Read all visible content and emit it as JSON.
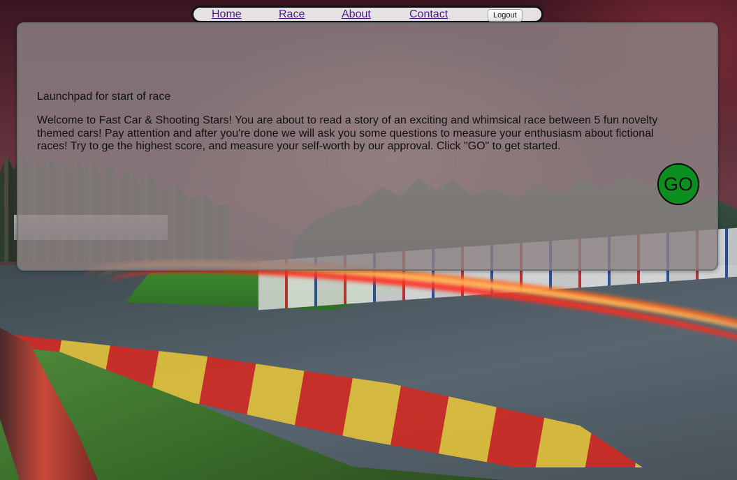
{
  "nav": {
    "links": [
      {
        "label": "Home"
      },
      {
        "label": "Race"
      },
      {
        "label": "About"
      },
      {
        "label": "Contact"
      }
    ],
    "logout_label": "Logout"
  },
  "main": {
    "heading": "Launchpad for start of race",
    "intro": "Welcome to Fast Car & Shooting Stars! You are about to read a story of an exciting and whimsical race between 5 fun novelty themed cars! Pay attention and after you're done we will ask you some questions to measure your enthusiasm about fictional races! Try to ge the highest score, and measure your self-worth by our approval. Click \"GO\" to get started.",
    "go_label": "GO"
  },
  "colors": {
    "nav_background": "#e6e2e4",
    "link": "#4b1c8c",
    "go_button": "#0b8f1f",
    "panel": "rgba(140,130,132,0.82)"
  }
}
